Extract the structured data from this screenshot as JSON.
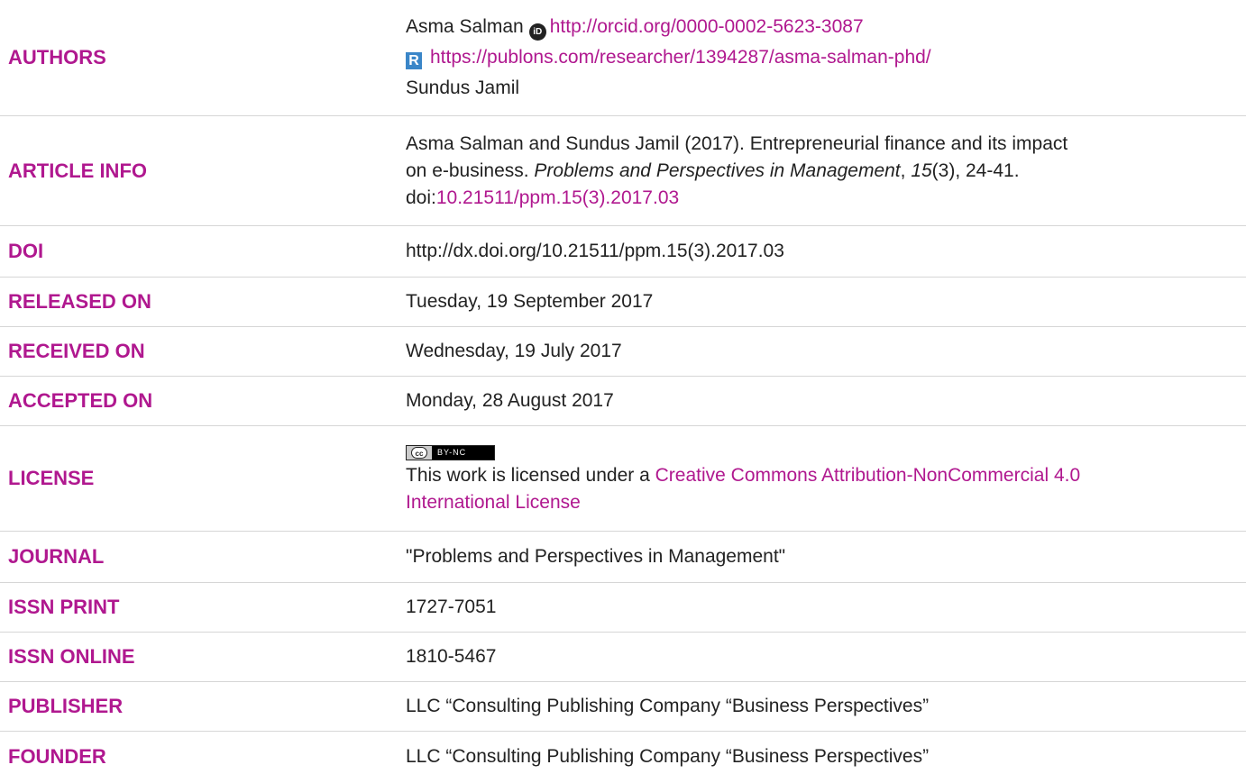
{
  "authors": {
    "label": "AUTHORS",
    "author1_name": "Asma Salman",
    "orcid_url": "http://orcid.org/0000-0002-5623-3087",
    "orcid_icon": "iD",
    "publons_icon": "R",
    "publons_url": "https://publons.com/researcher/1394287/asma-salman-phd/",
    "author2_name": "Sundus Jamil"
  },
  "article_info": {
    "label": "ARTICLE INFO",
    "citation_part1": "Asma Salman and Sundus Jamil (2017). Entrepreneurial finance and its impact",
    "citation_part2": "on e-business. ",
    "journal_italic": "Problems and Perspectives in Management",
    "sep1": ", ",
    "volume_italic": "15",
    "issue_pages": "(3), 24-41.",
    "doi_prefix": "doi:",
    "doi_link": "10.21511/ppm.15(3).2017.03"
  },
  "doi": {
    "label": "DOI",
    "value": "http://dx.doi.org/10.21511/ppm.15(3).2017.03"
  },
  "released_on": {
    "label": "RELEASED ON",
    "value": "Tuesday, 19 September 2017"
  },
  "received_on": {
    "label": "RECEIVED ON",
    "value": "Wednesday, 19 July 2017"
  },
  "accepted_on": {
    "label": "ACCEPTED ON",
    "value": "Monday, 28 August 2017"
  },
  "license": {
    "label": "LICENSE",
    "badge_cc": "cc",
    "badge_text": "BY-NC",
    "text_prefix": "This work is licensed under a ",
    "link_line1": "Creative Commons Attribution-NonCommercial 4.0",
    "link_line2": "International License"
  },
  "journal": {
    "label": "JOURNAL",
    "value": "\"Problems and Perspectives in Management\""
  },
  "issn_print": {
    "label": "ISSN PRINT",
    "value": "1727-7051"
  },
  "issn_online": {
    "label": "ISSN ONLINE",
    "value": "1810-5467"
  },
  "publisher": {
    "label": "PUBLISHER",
    "value": "LLC “Consulting Publishing Company “Business Perspectives”"
  },
  "founder": {
    "label": "FOUNDER",
    "value": "LLC “Consulting Publishing Company “Business Perspectives”"
  },
  "colors": {
    "accent": "#b0188f",
    "text": "#222222",
    "divider": "#d6d6d6"
  }
}
